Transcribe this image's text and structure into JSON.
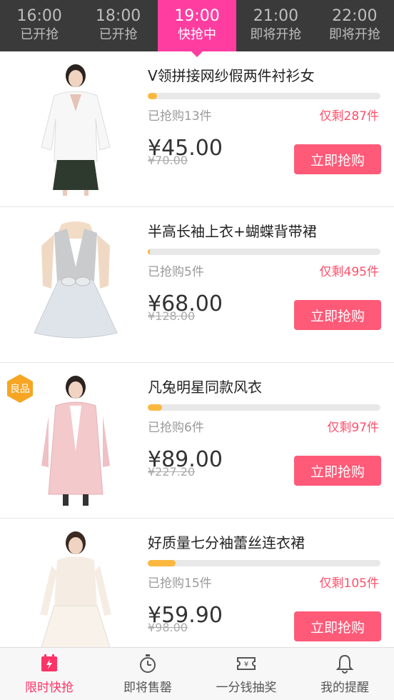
{
  "timebar": [
    {
      "time": "16:00",
      "status": "已开抢"
    },
    {
      "time": "18:00",
      "status": "已开抢"
    },
    {
      "time": "19:00",
      "status": "快抢中"
    },
    {
      "time": "21:00",
      "status": "即将开抢"
    },
    {
      "time": "22:00",
      "status": "即将开抢"
    }
  ],
  "active_slot": 2,
  "products": [
    {
      "title": "V领拼接网纱假两件衬衫女",
      "sold": "已抢购13件",
      "remaining": "仅剩287件",
      "price": "¥45.00",
      "original_price": "¥70.00",
      "button": "立即抢购",
      "progress": 0.04
    },
    {
      "title": "半高长袖上衣+蝴蝶背带裙",
      "sold": "已抢购5件",
      "remaining": "仅剩495件",
      "price": "¥68.00",
      "original_price": "¥128.00",
      "button": "立即抢购",
      "progress": 0.01
    },
    {
      "title": "凡兔明星同款风衣",
      "sold": "已抢购6件",
      "remaining": "仅剩97件",
      "price": "¥89.00",
      "original_price": "¥227.20",
      "button": "立即抢购",
      "progress": 0.06,
      "badge": "良品"
    },
    {
      "title": "好质量七分袖蕾丝连衣裙",
      "sold": "已抢购15件",
      "remaining": "仅剩105件",
      "price": "¥59.90",
      "original_price": "¥98.00",
      "button": "立即抢购",
      "progress": 0.12
    }
  ],
  "nav": [
    {
      "label": "限时快抢",
      "icon": "flash-calendar-icon"
    },
    {
      "label": "即将售罄",
      "icon": "stopwatch-icon"
    },
    {
      "label": "一分钱抽奖",
      "icon": "yen-ticket-icon"
    },
    {
      "label": "我的提醒",
      "icon": "bell-icon"
    }
  ],
  "colors": {
    "accent": "#ff3da0",
    "button": "#ff5a78",
    "progress": "#fbb83f",
    "remaining": "#ff4f6a",
    "nav_active": "#ff3366",
    "timebar_bg": "#3a3a3a"
  }
}
